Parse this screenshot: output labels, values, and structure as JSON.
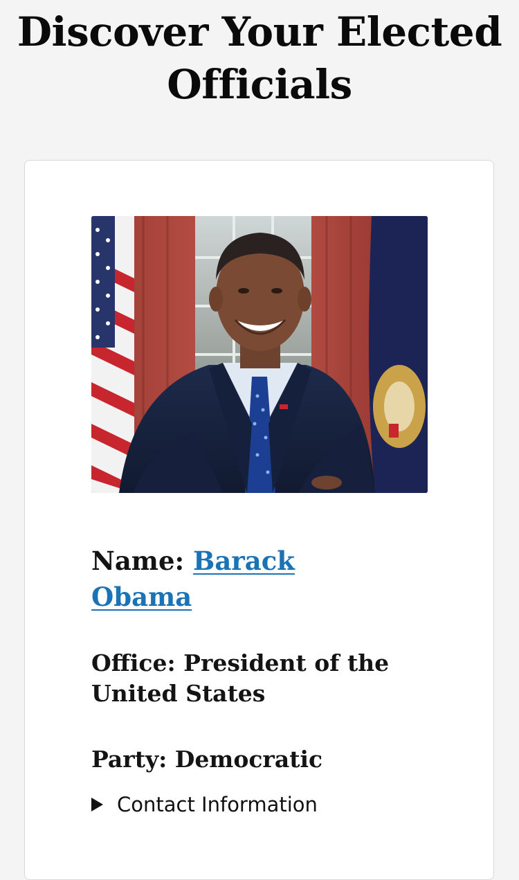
{
  "page": {
    "title": "Discover Your Elected Officials"
  },
  "official": {
    "name_label": "Name:",
    "name": "Barack Obama",
    "office_label": "Office:",
    "office": "President of the United States",
    "party_label": "Party:",
    "party": "Democratic",
    "contact_toggle": "Contact Information"
  },
  "colors": {
    "background": "#f4f4f4",
    "card": "#ffffff",
    "link": "#1a73b5",
    "text": "#111111"
  },
  "icons": {
    "disclosure": "disclosure-triangle-right-icon"
  }
}
